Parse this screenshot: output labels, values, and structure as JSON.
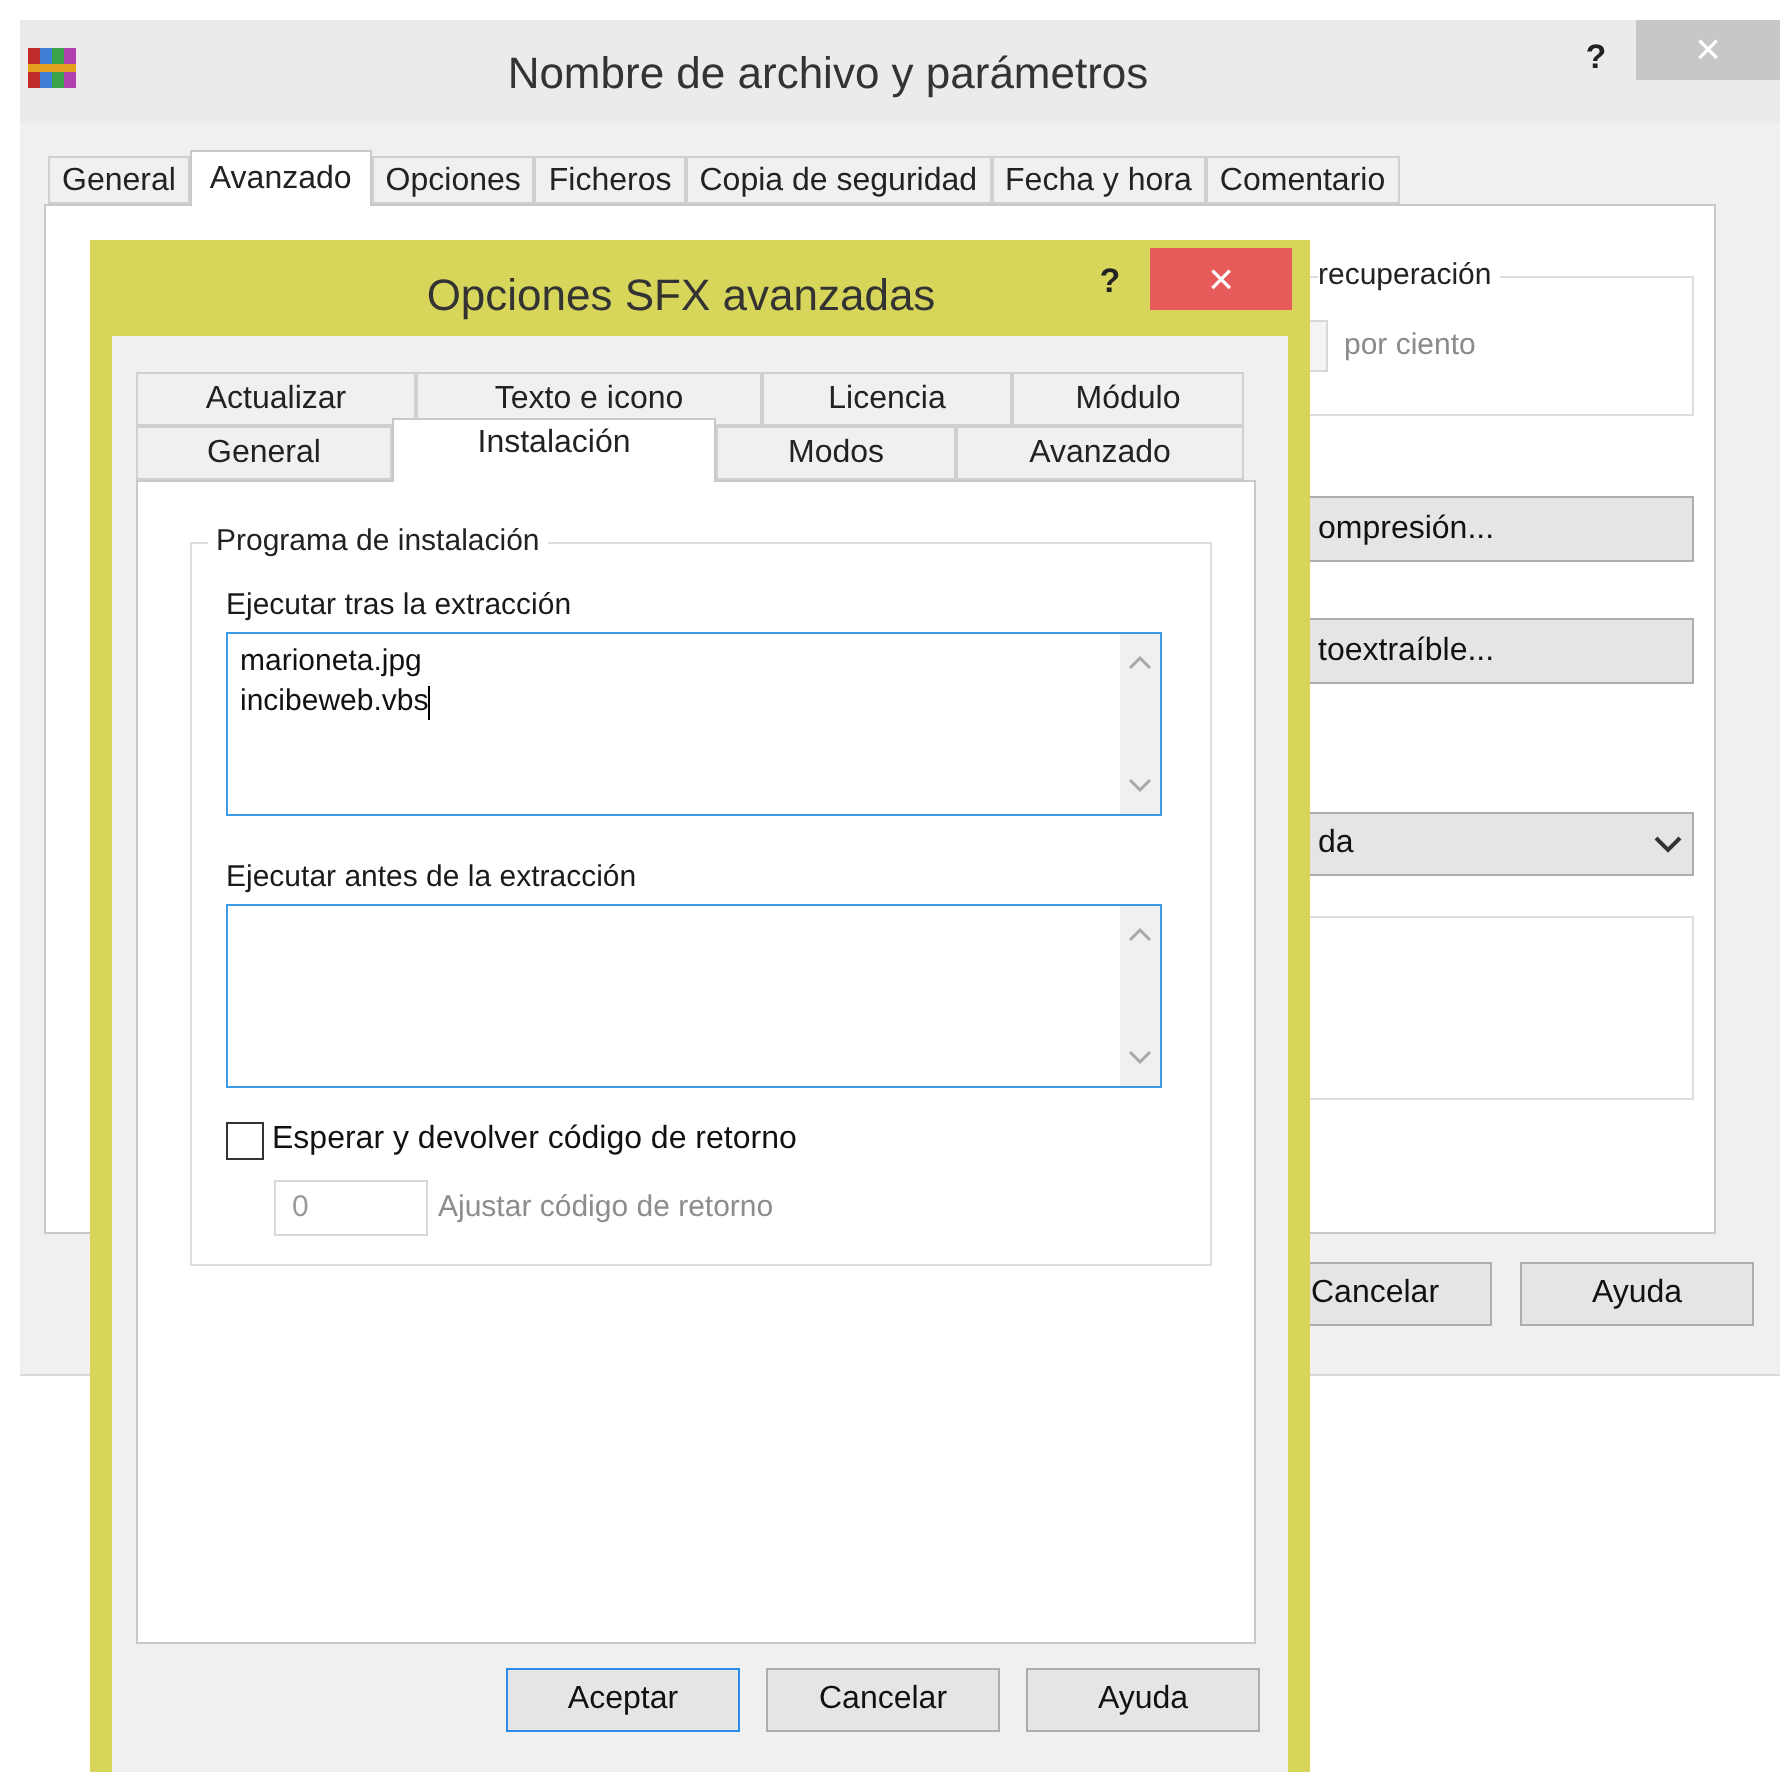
{
  "main_window": {
    "title": "Nombre de archivo y parámetros",
    "help": "?",
    "close": "×",
    "tabs": [
      {
        "label": "General",
        "selected": false
      },
      {
        "label": "Avanzado",
        "selected": true
      },
      {
        "label": "Opciones",
        "selected": false
      },
      {
        "label": "Ficheros",
        "selected": false
      },
      {
        "label": "Copia de seguridad",
        "selected": false
      },
      {
        "label": "Fecha y hora",
        "selected": false
      },
      {
        "label": "Comentario",
        "selected": false
      }
    ],
    "recovery_group": {
      "label": "recuperación",
      "unit": "por ciento"
    },
    "buttons": [
      "ompresión...",
      "toextraíble..."
    ],
    "dropdown": {
      "value": "da"
    },
    "footer_buttons": [
      "Cancelar",
      "Ayuda"
    ]
  },
  "dialog": {
    "title": "Opciones SFX avanzadas",
    "help": "?",
    "close": "×",
    "tab_rows": [
      [
        {
          "label": "Actualizar",
          "selected": false
        },
        {
          "label": "Texto e icono",
          "selected": false
        },
        {
          "label": "Licencia",
          "selected": false
        },
        {
          "label": "Módulo",
          "selected": false
        }
      ],
      [
        {
          "label": "General",
          "selected": false
        },
        {
          "label": "Instalación",
          "selected": true
        },
        {
          "label": "Modos",
          "selected": false
        },
        {
          "label": "Avanzado",
          "selected": false
        }
      ]
    ],
    "group": {
      "label": "Programa de instalación",
      "fields": [
        {
          "label": "Ejecutar tras la extracción",
          "value": "marioneta.jpg\nincibeweb.vbs",
          "caret": true
        },
        {
          "label": "Ejecutar antes de la extracción",
          "caret": false
        }
      ]
    },
    "checkbox": {
      "label": "Esperar y devolver código de retorno",
      "checked": false
    },
    "return_code": {
      "value": "0",
      "label": "Ajustar código de retorno",
      "disabled": true
    },
    "buttons": [
      {
        "label": "Aceptar",
        "default": true
      },
      {
        "label": "Cancelar",
        "default": false
      },
      {
        "label": "Ayuda",
        "default": false
      }
    ]
  }
}
